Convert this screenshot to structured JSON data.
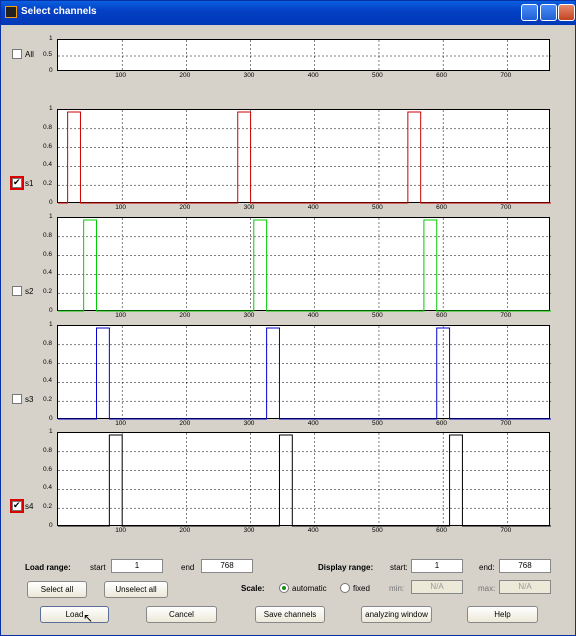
{
  "window": {
    "title": "Select channels"
  },
  "ticks": {
    "y": [
      "1",
      "0.8",
      "0.6",
      "0.4",
      "0.2",
      "0"
    ],
    "y_all": [
      "1",
      "0.5",
      "0"
    ],
    "x": [
      "100",
      "200",
      "300",
      "400",
      "500",
      "600",
      "700"
    ]
  },
  "channels": [
    {
      "label": "All",
      "checked": false,
      "highlight": false,
      "color": "#000000",
      "pulses": []
    },
    {
      "label": "s1",
      "checked": true,
      "highlight": true,
      "color": "#cc0000",
      "pulses": [
        [
          15,
          35
        ],
        [
          280,
          300
        ],
        [
          545,
          565
        ]
      ]
    },
    {
      "label": "s2",
      "checked": false,
      "highlight": false,
      "color": "#00cc00",
      "pulses": [
        [
          40,
          60
        ],
        [
          305,
          325
        ],
        [
          570,
          590
        ]
      ]
    },
    {
      "label": "s3",
      "checked": false,
      "highlight": false,
      "color": "#0000cc",
      "pulses": [
        [
          60,
          80
        ],
        [
          325,
          345
        ],
        [
          590,
          610
        ]
      ]
    },
    {
      "label": "s4",
      "checked": true,
      "highlight": true,
      "color": "#000000",
      "pulses": [
        [
          80,
          100
        ],
        [
          345,
          365
        ],
        [
          610,
          630
        ]
      ]
    }
  ],
  "load_range": {
    "label": "Load range:",
    "start_label": "start",
    "start": "1",
    "end_label": "end",
    "end": "768"
  },
  "display_range": {
    "label": "Display range:",
    "start_label": "start:",
    "start": "1",
    "end_label": "end:",
    "end": "768"
  },
  "scale": {
    "label": "Scale:",
    "automatic": "automatic",
    "fixed": "fixed",
    "selected": "automatic",
    "min_label": "min:",
    "min": "N/A",
    "max_label": "max:",
    "max": "N/A"
  },
  "buttons": {
    "select_all": "Select all",
    "unselect_all": "Unselect all",
    "load": "Load",
    "cancel": "Cancel",
    "save": "Save channels",
    "analyzing": "analyzing window",
    "help": "Help"
  }
}
